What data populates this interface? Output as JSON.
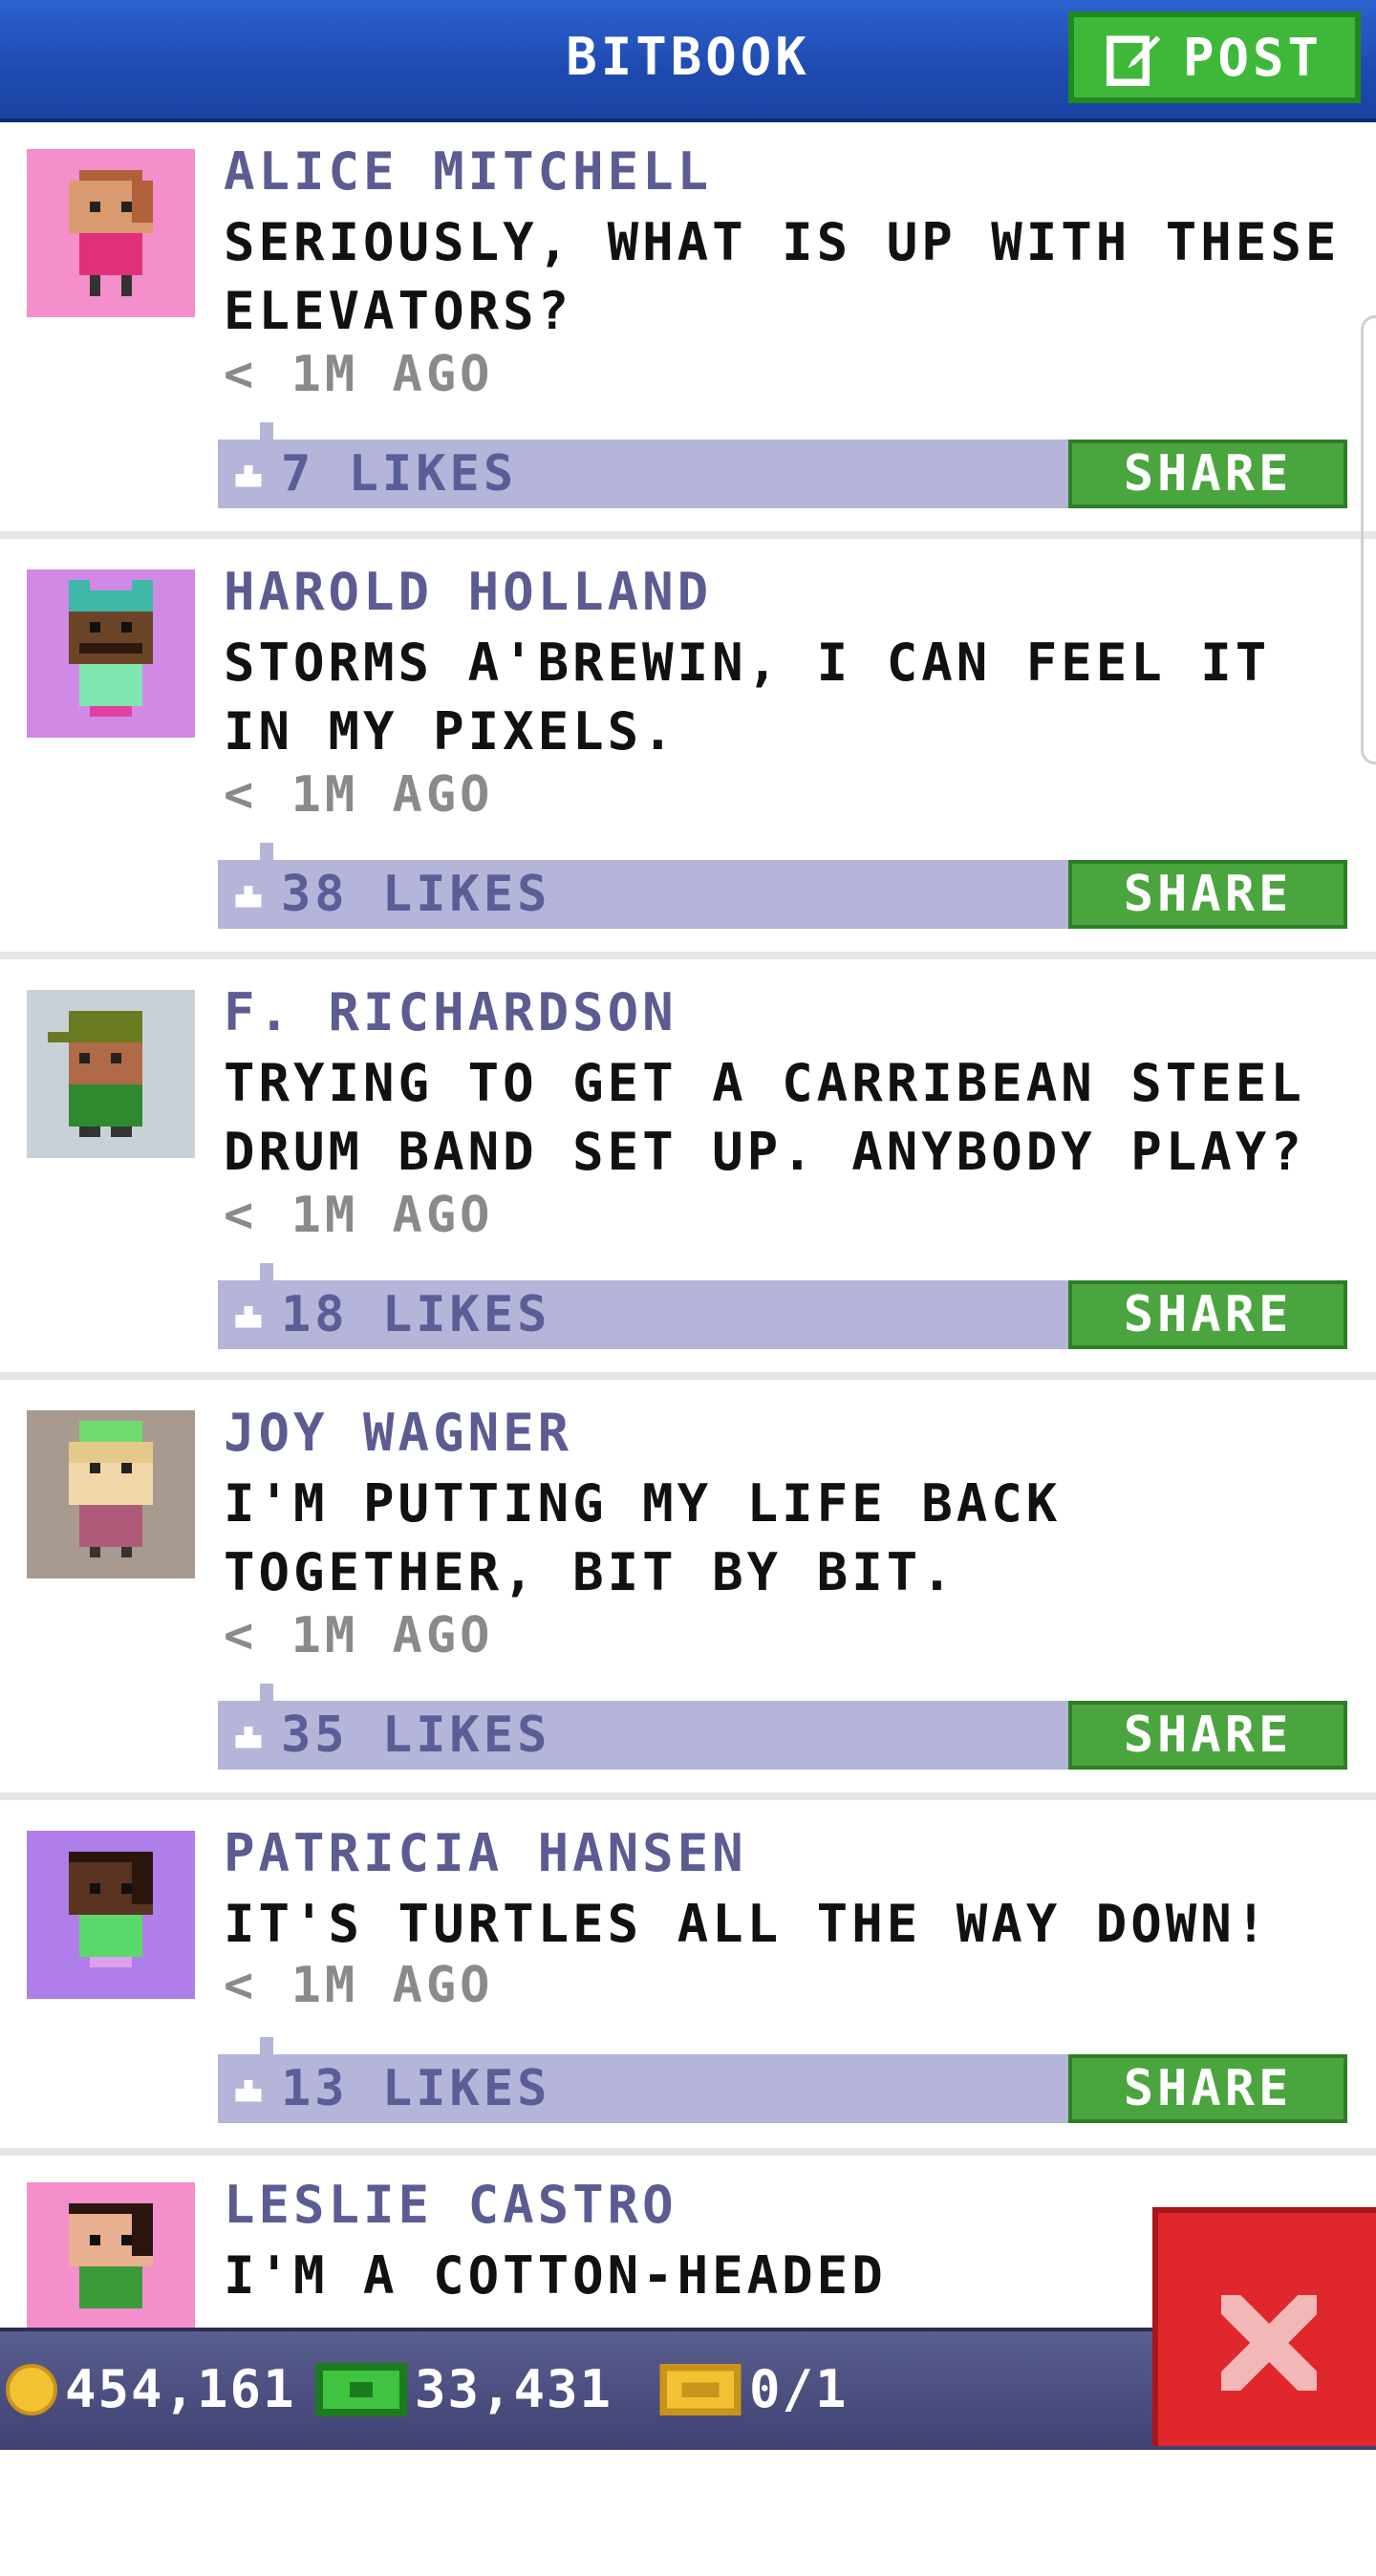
{
  "header": {
    "title": "BITBOOK",
    "post_label": "POST"
  },
  "posts": [
    {
      "author": "ALICE MITCHELL",
      "message": "SERIOUSLY, WHAT IS UP WITH THESE ELEVATORS?",
      "time": "< 1M AGO",
      "likes": "7 LIKES",
      "share_label": "SHARE",
      "avatar_bg": "#f48fcb"
    },
    {
      "author": "HAROLD HOLLAND",
      "message": "STORMS A'BREWIN, I CAN FEEL IT IN MY PIXELS.",
      "time": "< 1M AGO",
      "likes": "38 LIKES",
      "share_label": "SHARE",
      "avatar_bg": "#d08ae6"
    },
    {
      "author": "F. RICHARDSON",
      "message": "TRYING TO GET A CARRIBEAN STEEL DRUM BAND SET UP. ANYBODY PLAY?",
      "time": "< 1M AGO",
      "likes": "18 LIKES",
      "share_label": "SHARE",
      "avatar_bg": "#c8d2d6"
    },
    {
      "author": "JOY WAGNER",
      "message": "I'M PUTTING MY LIFE BACK TOGETHER, BIT BY BIT.",
      "time": "< 1M AGO",
      "likes": "35 LIKES",
      "share_label": "SHARE",
      "avatar_bg": "#a89a8e"
    },
    {
      "author": "PATRICIA HANSEN",
      "message": "IT'S TURTLES ALL THE WAY DOWN!",
      "time": "< 1M AGO",
      "likes": "13 LIKES",
      "share_label": "SHARE",
      "avatar_bg": "#b07ee8"
    },
    {
      "author": "LESLIE CASTRO",
      "message": "I'M A COTTON-HEADED",
      "time": "",
      "likes": "",
      "share_label": "",
      "avatar_bg": "#f48fcb"
    }
  ],
  "status": {
    "coins": "454,161",
    "cash": "33,431",
    "bux": "0/1"
  },
  "colors": {
    "header_blue": "#1e4ab0",
    "post_green": "#3fb83a",
    "author_purple": "#5c5c92",
    "likebar": "#b4b5d8",
    "share_green": "#4ba53e",
    "close_red": "#e0282c"
  },
  "icons": {
    "post": "edit-icon",
    "like": "thumbs-up-icon",
    "coin": "coin-icon",
    "cash": "cash-icon",
    "bux": "ticket-icon",
    "close": "close-icon"
  }
}
